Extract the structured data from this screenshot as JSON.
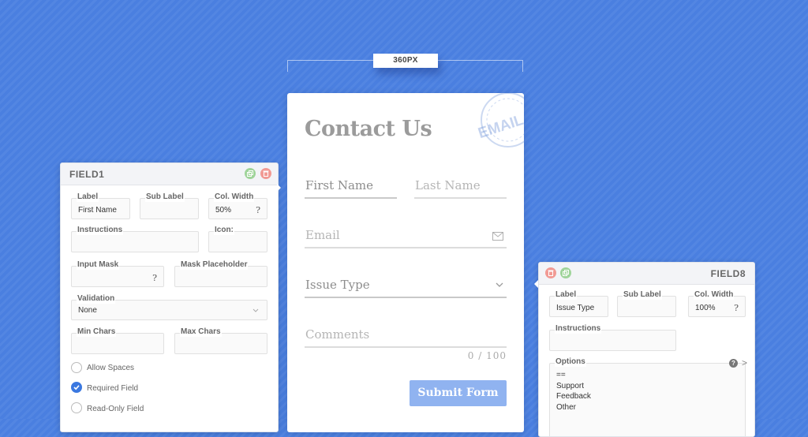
{
  "ruler": {
    "label": "360PX"
  },
  "form": {
    "title": "Contact Us",
    "stamp_text": "EMAIL",
    "stamp_ring": "MAIL",
    "fields": {
      "first_name": "First Name",
      "last_name": "Last Name",
      "email": "Email",
      "issue_type": "Issue Type",
      "comments": "Comments"
    },
    "counter": "0 / 100",
    "submit_label": "Submit Form"
  },
  "field1_panel": {
    "title": "FIELD1",
    "label": {
      "legend": "Label",
      "value": "First Name"
    },
    "sub_label": {
      "legend": "Sub Label",
      "value": ""
    },
    "col_width": {
      "legend": "Col. Width",
      "value": "50%",
      "help": "?"
    },
    "instructions": {
      "legend": "Instructions",
      "value": ""
    },
    "icon": {
      "legend": "Icon:",
      "value": ""
    },
    "input_mask": {
      "legend": "Input Mask",
      "value": "",
      "help": "?"
    },
    "mask_placeholder": {
      "legend": "Mask Placeholder",
      "value": ""
    },
    "validation": {
      "legend": "Validation",
      "value": "None"
    },
    "min_chars": {
      "legend": "Min Chars",
      "value": ""
    },
    "max_chars": {
      "legend": "Max Chars",
      "value": ""
    },
    "checks": [
      {
        "label": "Allow Spaces",
        "checked": false
      },
      {
        "label": "Required Field",
        "checked": true
      },
      {
        "label": "Read-Only Field",
        "checked": false
      }
    ]
  },
  "field8_panel": {
    "title": "FIELD8",
    "label": {
      "legend": "Label",
      "value": "Issue Type"
    },
    "sub_label": {
      "legend": "Sub Label",
      "value": ""
    },
    "col_width": {
      "legend": "Col. Width",
      "value": "100%",
      "help": "?"
    },
    "instructions": {
      "legend": "Instructions",
      "value": ""
    },
    "options": {
      "legend": "Options",
      "items": [
        "==",
        "Support",
        "Feedback",
        "Other"
      ]
    }
  },
  "colors": {
    "background": "#4a7fe0",
    "submit": "#90b3f0",
    "checkbox_on": "#3b78e0",
    "copy_icon": "#9fd49a",
    "delete_icon": "#f19a94"
  }
}
